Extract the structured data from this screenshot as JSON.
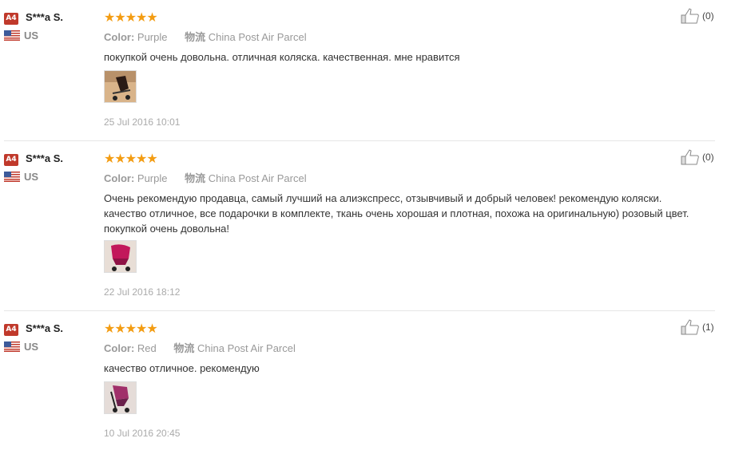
{
  "reviews": [
    {
      "badge": "A4",
      "user": "S***a S.",
      "country": "US",
      "stars": "★★★★★",
      "color_label": "Color:",
      "color_value": "Purple",
      "shipping_label": "物流",
      "shipping_value": "China Post Air Parcel",
      "text": "покупкой очень довольна. отличная коляска. качественная. мне нравится",
      "date": "25 Jul 2016 10:01",
      "helpful": "(0)",
      "thumb_color": "#6b4a3a"
    },
    {
      "badge": "A4",
      "user": "S***a S.",
      "country": "US",
      "stars": "★★★★★",
      "color_label": "Color:",
      "color_value": "Purple",
      "shipping_label": "物流",
      "shipping_value": "China Post Air Parcel",
      "text": "Очень рекомендую продавца, самый лучший на алиэкспресс, отзывчивый и добрый человек! рекомендую коляски. качество отличное, все подарочки в комплекте, ткань очень хорошая и плотная, похожа на оригинальную) розовый цвет. покупкой очень довольна!",
      "date": "22 Jul 2016 18:12",
      "helpful": "(0)",
      "thumb_color": "#c2185b"
    },
    {
      "badge": "A4",
      "user": "S***a S.",
      "country": "US",
      "stars": "★★★★★",
      "color_label": "Color:",
      "color_value": "Red",
      "shipping_label": "物流",
      "shipping_value": "China Post Air Parcel",
      "text": "качество отличное. рекомендую",
      "date": "10 Jul 2016 20:45",
      "helpful": "(1)",
      "thumb_color": "#a0306a"
    }
  ],
  "colors": {
    "star": "#f39c12",
    "badge": "#c0392b",
    "muted": "#999999"
  }
}
